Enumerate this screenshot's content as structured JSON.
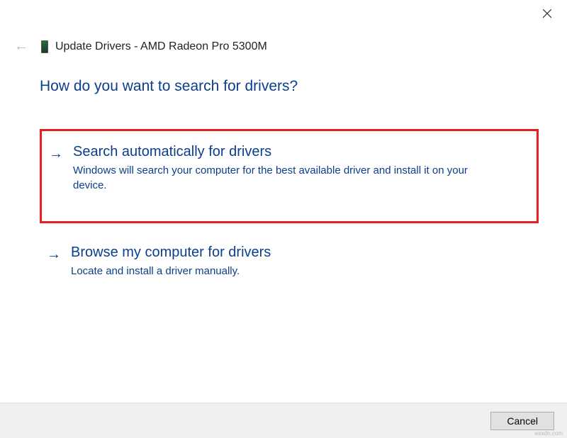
{
  "window": {
    "title": "Update Drivers - AMD Radeon Pro 5300M"
  },
  "heading": "How do you want to search for drivers?",
  "options": [
    {
      "title": "Search automatically for drivers",
      "description": "Windows will search your computer for the best available driver and install it on your device.",
      "highlighted": true
    },
    {
      "title": "Browse my computer for drivers",
      "description": "Locate and install a driver manually.",
      "highlighted": false
    }
  ],
  "footer": {
    "cancel_label": "Cancel"
  },
  "watermark": "wsxdn.com"
}
